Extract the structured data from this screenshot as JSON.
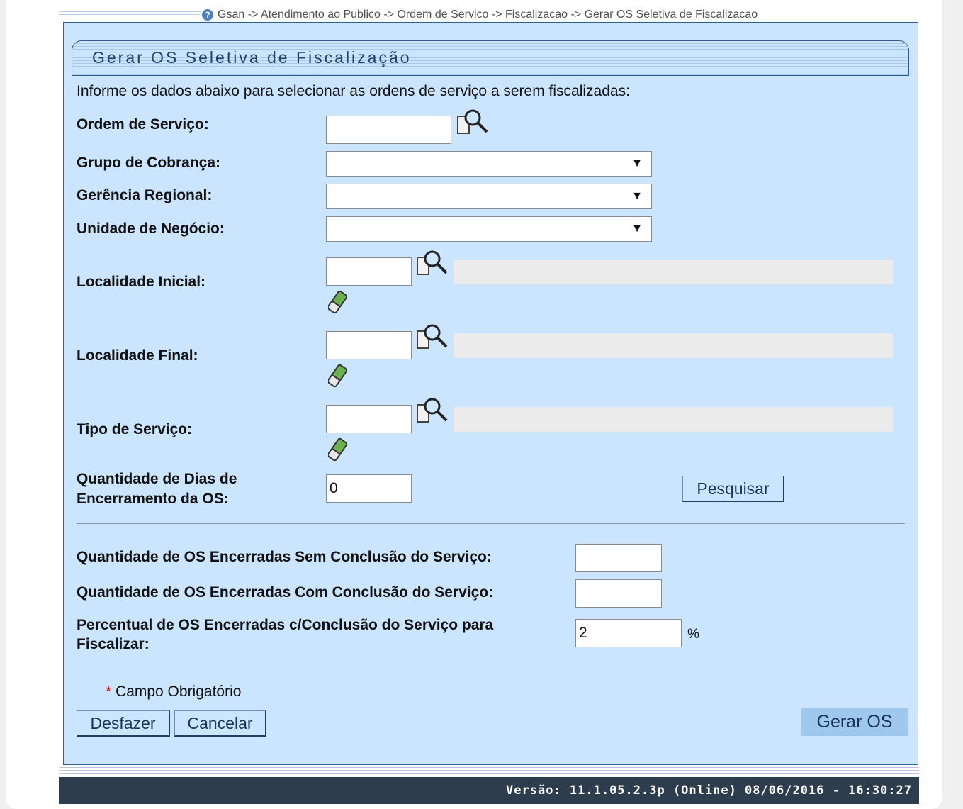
{
  "breadcrumb": "Gsan -> Atendimento ao Publico -> Ordem de Servico -> Fiscalizacao -> Gerar OS Seletiva de Fiscalizacao",
  "title": "Gerar OS Seletiva de Fiscalização",
  "instructions": "Informe os dados abaixo para selecionar as ordens de serviço a serem fiscalizadas:",
  "fields": {
    "ordem_servico": {
      "label": "Ordem de Serviço:",
      "value": ""
    },
    "grupo_cobranca": {
      "label": "Grupo de Cobrança:",
      "selected": ""
    },
    "gerencia_regional": {
      "label": "Gerência Regional:",
      "selected": ""
    },
    "unidade_negocio": {
      "label": "Unidade de Negócio:",
      "selected": ""
    },
    "localidade_inicial": {
      "label": "Localidade Inicial:",
      "value": "",
      "description": ""
    },
    "localidade_final": {
      "label": "Localidade Final:",
      "value": "",
      "description": ""
    },
    "tipo_servico": {
      "label": "Tipo de Serviço:",
      "value": "",
      "description": ""
    },
    "qtd_dias": {
      "label_line1": "Quantidade de Dias de",
      "label_line2": "Encerramento da OS:",
      "value": "0"
    },
    "qtd_sem_conclusao": {
      "label": "Quantidade de OS Encerradas Sem Conclusão do Serviço:",
      "value": ""
    },
    "qtd_com_conclusao": {
      "label": "Quantidade de OS Encerradas Com Conclusão do Serviço:",
      "value": ""
    },
    "percentual": {
      "label_line1": "Percentual de OS Encerradas c/Conclusão do Serviço para",
      "label_line2": "Fiscalizar:",
      "value": "2",
      "unit": "%"
    }
  },
  "buttons": {
    "pesquisar": "Pesquisar",
    "desfazer": "Desfazer",
    "cancelar": "Cancelar",
    "gerar_os": "Gerar OS"
  },
  "required_note": {
    "star": "*",
    "text": " Campo Obrigatório"
  },
  "footer": "Versão: 11.1.05.2.3p (Online) 08/06/2016 - 16:30:27",
  "icons": {
    "lookup": "magnifier-lookup-icon",
    "clear": "eraser-icon",
    "help": "help-icon"
  },
  "colors": {
    "panel_bg": "#cbe5fe",
    "footer_bg": "#2e3d4e",
    "title_text": "#21406b"
  }
}
